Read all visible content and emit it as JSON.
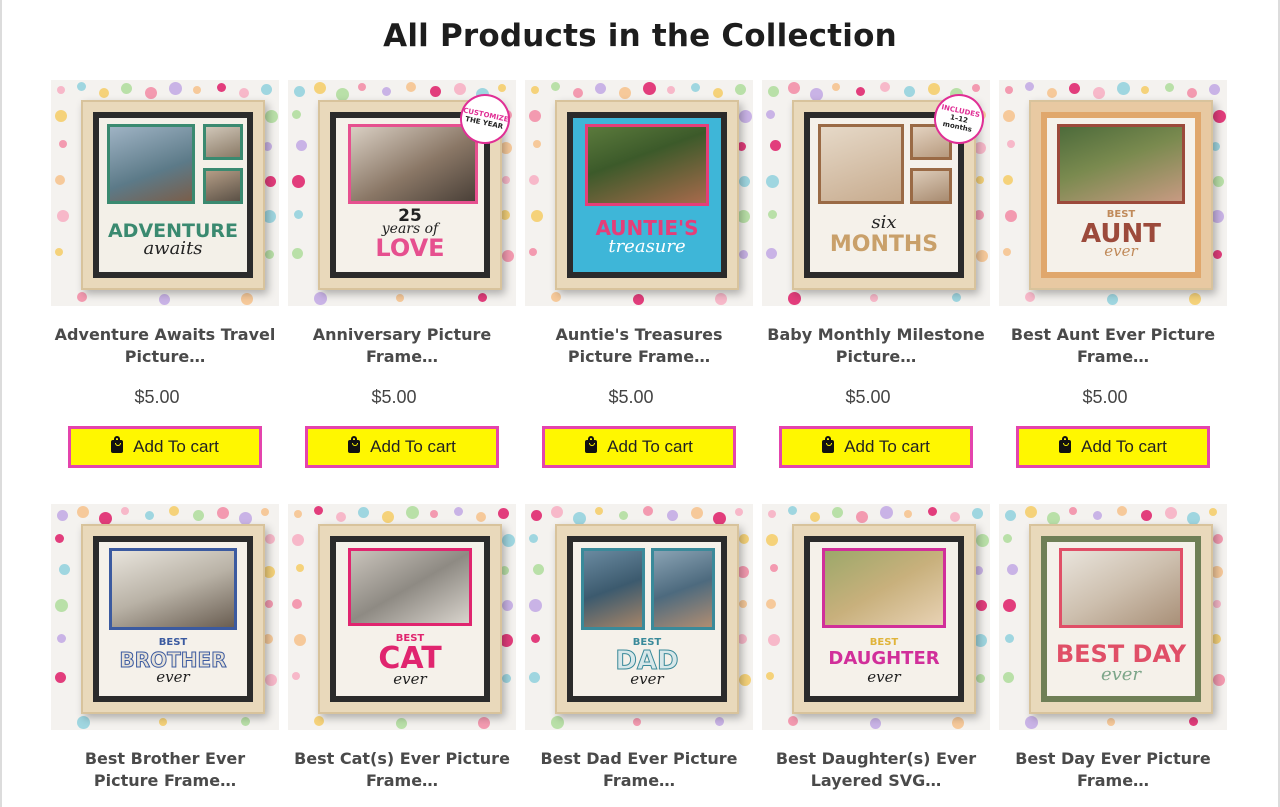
{
  "section": {
    "title": "All Products in the Collection"
  },
  "products": [
    {
      "name": "Adventure Awaits Travel Picture…",
      "price": "$5.00",
      "button": "Add To cart",
      "art": {
        "big": "ADVENTURE",
        "script": "awaits",
        "accent": "#3a8a70"
      }
    },
    {
      "name": "Anniversary Picture Frame…",
      "price": "$5.00",
      "button": "Add To cart",
      "art": {
        "num": "25",
        "script": "years of",
        "big": "LOVE",
        "accent": "#e6508f",
        "sticker_line1": "CUSTOMIZE",
        "sticker_line2": "THE YEAR"
      }
    },
    {
      "name": "Auntie's Treasures Picture Frame…",
      "price": "$5.00",
      "button": "Add To cart",
      "art": {
        "big": "AUNTIE'S",
        "script": "treasure",
        "accent": "#e53e79",
        "accent2": "#3eb6d8"
      }
    },
    {
      "name": "Baby Monthly Milestone Picture…",
      "price": "$5.00",
      "button": "Add To cart",
      "art": {
        "script": "six",
        "big": "MONTHS",
        "accent": "#c9a06a",
        "sticker_line1": "INCLUDES",
        "sticker_line2": "1–12",
        "sticker_line3": "months"
      }
    },
    {
      "name": "Best Aunt Ever Picture Frame…",
      "price": "$5.00",
      "button": "Add To cart",
      "art": {
        "small": "BEST",
        "big": "AUNT",
        "script": "ever",
        "accent": "#9c4a3b"
      }
    },
    {
      "name": "Best Brother Ever Picture Frame…",
      "price": "",
      "button": "",
      "art": {
        "small": "BEST",
        "big": "BROTHER",
        "script": "ever",
        "accent": "#3b5aa0"
      }
    },
    {
      "name": "Best Cat(s) Ever Picture Frame…",
      "price": "",
      "button": "",
      "art": {
        "small": "BEST",
        "big": "CAT",
        "script": "ever",
        "accent": "#e0256f"
      }
    },
    {
      "name": "Best Dad Ever Picture Frame…",
      "price": "",
      "button": "",
      "art": {
        "small": "BEST",
        "big": "DAD",
        "script": "ever",
        "accent": "#3a8a9a"
      }
    },
    {
      "name": "Best Daughter(s) Ever Layered SVG…",
      "price": "",
      "button": "",
      "art": {
        "small": "BEST",
        "big": "DAUGHTER",
        "script": "ever",
        "accent": "#d12f9a"
      }
    },
    {
      "name": "Best Day Ever Picture Frame…",
      "price": "",
      "button": "",
      "art": {
        "big": "BEST DAY",
        "script": "ever",
        "accent": "#e04f67"
      }
    }
  ]
}
